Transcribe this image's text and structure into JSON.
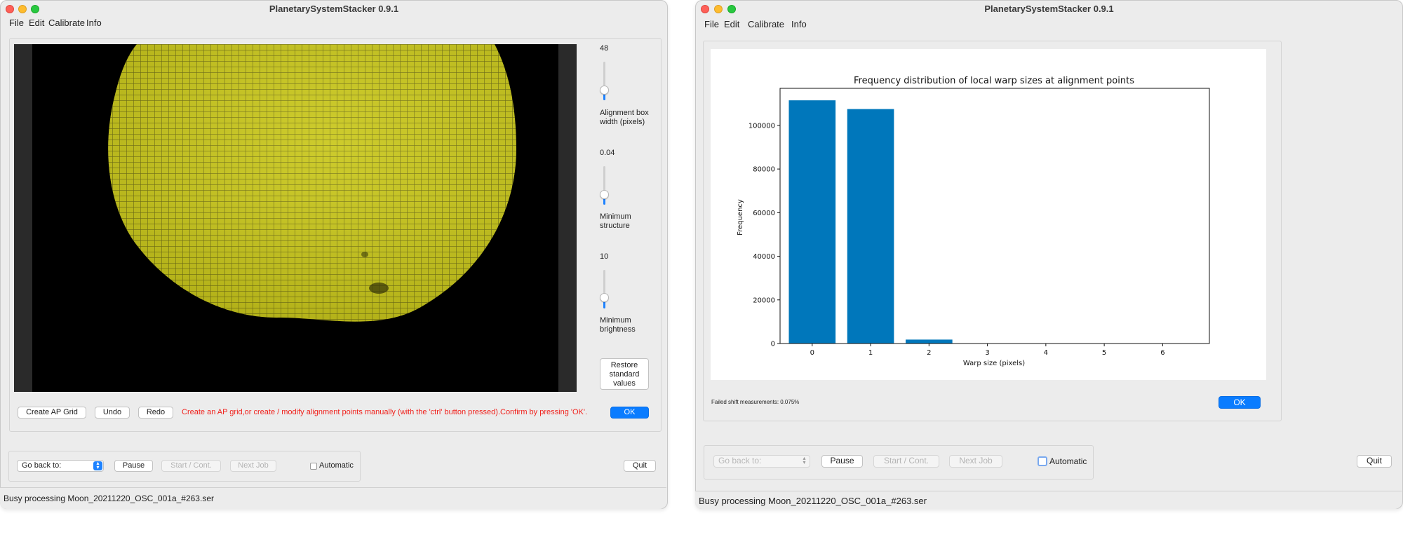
{
  "window1": {
    "title": "PlanetarySystemStacker 0.9.1",
    "menu": [
      "File",
      "Edit",
      "Calibrate",
      "Info"
    ],
    "sliders": [
      {
        "value_label": "48",
        "caption_lines": [
          "Alignment box",
          "width (pixels)"
        ],
        "level": 0.08
      },
      {
        "value_label": "0.04",
        "caption_lines": [
          "Minimum",
          "structure"
        ],
        "level": 0.08
      },
      {
        "value_label": "10",
        "caption_lines": [
          "Minimum",
          "brightness"
        ],
        "level": 0.08
      }
    ],
    "restore_button_lines": [
      "Restore",
      "standard",
      "values"
    ],
    "create_ap_grid": "Create AP Grid",
    "undo": "Undo",
    "redo": "Redo",
    "instruction": "Create an AP grid,or create / modify alignment points manually (with the 'ctrl' button pressed).Confirm by pressing 'OK'.",
    "ok": "OK",
    "go_back_label": "Go back to:",
    "pause": "Pause",
    "start_cont": "Start / Cont.",
    "next_job": "Next Job",
    "automatic": "Automatic",
    "quit": "Quit",
    "status": "Busy processing Moon_20211220_OSC_001a_#263.ser",
    "colors": {
      "moon": "#c9c71a",
      "ap_grid": "#6f6e12",
      "accent": "#0a7cff",
      "message": "#f0211c"
    }
  },
  "window2": {
    "title": "PlanetarySystemStacker 0.9.1",
    "menu": [
      "File",
      "Edit",
      "Calibrate",
      "Info"
    ],
    "failed_shift": "Failed shift measurements: 0.075%",
    "ok": "OK",
    "go_back_label": "Go back to:",
    "pause": "Pause",
    "start_cont": "Start / Cont.",
    "next_job": "Next Job",
    "automatic": "Automatic",
    "quit": "Quit",
    "status": "Busy processing Moon_20211220_OSC_001a_#263.ser"
  },
  "chart_data": {
    "type": "bar",
    "title": "Frequency distribution of local warp sizes at alignment points",
    "xlabel": "Warp size (pixels)",
    "ylabel": "Frequency",
    "categories": [
      "0",
      "1",
      "2",
      "3",
      "4",
      "5",
      "6"
    ],
    "values": [
      111500,
      107500,
      1800,
      0,
      0,
      0,
      0
    ],
    "x_ticks": [
      "0",
      "1",
      "2",
      "3",
      "4",
      "5",
      "6"
    ],
    "y_ticks": [
      "0",
      "20000",
      "40000",
      "60000",
      "80000",
      "100000"
    ],
    "ylim": [
      0,
      117000
    ],
    "bar_color": "#0077bb",
    "grid": false,
    "legend": "none"
  }
}
